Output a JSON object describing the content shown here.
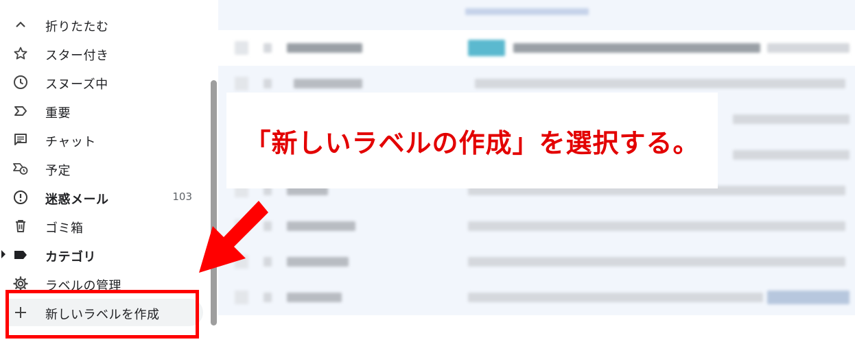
{
  "sidebar": {
    "items": [
      {
        "label": "折りたたむ",
        "icon": "chevron-up-icon"
      },
      {
        "label": "スター付き",
        "icon": "star-icon"
      },
      {
        "label": "スヌーズ中",
        "icon": "clock-icon"
      },
      {
        "label": "重要",
        "icon": "important-icon"
      },
      {
        "label": "チャット",
        "icon": "chat-icon"
      },
      {
        "label": "予定",
        "icon": "scheduled-icon"
      },
      {
        "label": "迷惑メール",
        "icon": "spam-icon",
        "count": "103"
      },
      {
        "label": "ゴミ箱",
        "icon": "trash-icon"
      },
      {
        "label": "カテゴリ",
        "icon": "label-icon"
      },
      {
        "label": "ラベルの管理",
        "icon": "gear-icon"
      },
      {
        "label": "新しいラベルを作成",
        "icon": "plus-icon"
      }
    ]
  },
  "callout": {
    "text": "「新しいラベルの作成」を選択する。"
  },
  "colors": {
    "annotation_red": "#ff0000",
    "callout_text_red": "#e30000"
  }
}
